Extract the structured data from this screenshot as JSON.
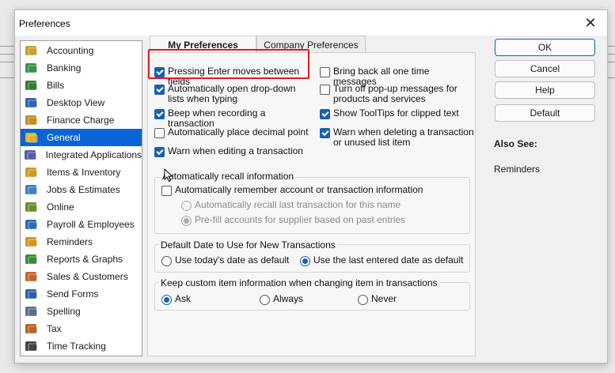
{
  "window": {
    "title": "Preferences",
    "close_glyph": "✕"
  },
  "sidebar": {
    "items": [
      {
        "label": "Accounting",
        "icon": "accounting-icon"
      },
      {
        "label": "Banking",
        "icon": "banking-icon"
      },
      {
        "label": "Bills",
        "icon": "bills-icon"
      },
      {
        "label": "Desktop View",
        "icon": "desktop-view-icon"
      },
      {
        "label": "Finance Charge",
        "icon": "finance-charge-icon"
      },
      {
        "label": "General",
        "icon": "general-icon",
        "selected": true
      },
      {
        "label": "Integrated Applications",
        "icon": "integrated-apps-icon"
      },
      {
        "label": "Items & Inventory",
        "icon": "items-inventory-icon"
      },
      {
        "label": "Jobs & Estimates",
        "icon": "jobs-estimates-icon"
      },
      {
        "label": "Online",
        "icon": "online-icon"
      },
      {
        "label": "Payroll & Employees",
        "icon": "payroll-icon"
      },
      {
        "label": "Reminders",
        "icon": "bell-icon"
      },
      {
        "label": "Reports & Graphs",
        "icon": "reports-icon"
      },
      {
        "label": "Sales & Customers",
        "icon": "sales-icon"
      },
      {
        "label": "Send Forms",
        "icon": "send-forms-icon"
      },
      {
        "label": "Spelling",
        "icon": "spelling-icon"
      },
      {
        "label": "Tax",
        "icon": "tax-icon"
      },
      {
        "label": "Time Tracking",
        "icon": "time-tracking-icon"
      }
    ]
  },
  "tabs": {
    "my_preferences": "My Preferences",
    "company_preferences": "Company Preferences"
  },
  "options": {
    "enter_moves": "Pressing Enter moves between fields",
    "auto_dropdown": "Automatically open drop-down lists when typing",
    "beep": "Beep when recording a transaction",
    "decimal": "Automatically place decimal point",
    "warn_editing": "Warn when editing a transaction",
    "bring_back": "Bring back all one time messages",
    "turn_off_popup": "Turn off pop-up messages for products and services",
    "tooltips": "Show ToolTips for clipped text",
    "warn_deleting": "Warn when deleting a transaction or unused list item"
  },
  "recall": {
    "group_title": "Automatically recall information",
    "remember": "Automatically remember account or transaction information",
    "recall_last": "Automatically recall last transaction for this name",
    "prefill": "Pre-fill accounts for supplier based on past entries"
  },
  "default_date": {
    "group_title": "Default Date to Use for New Transactions",
    "today": "Use today's date as default",
    "last_entered": "Use the last entered date as default"
  },
  "custom_item": {
    "group_title": "Keep custom item information when changing item in transactions",
    "ask": "Ask",
    "always": "Always",
    "never": "Never"
  },
  "buttons": {
    "ok": "OK",
    "cancel": "Cancel",
    "help": "Help",
    "default": "Default"
  },
  "also_see": {
    "title": "Also See:",
    "link": "Reminders"
  }
}
